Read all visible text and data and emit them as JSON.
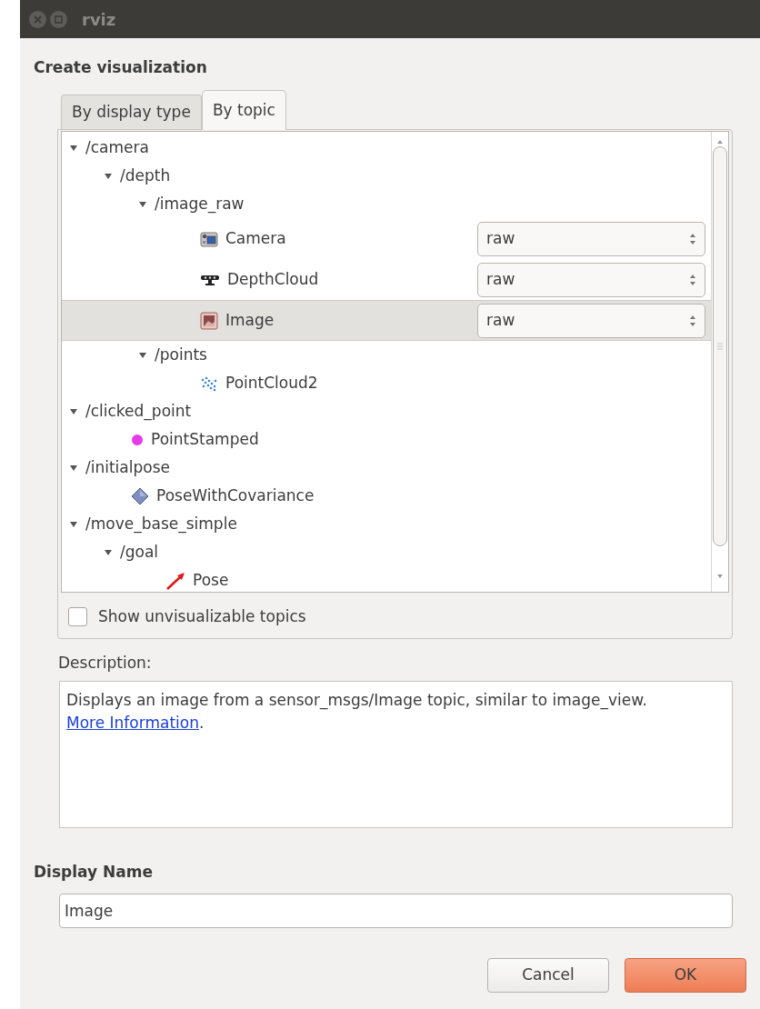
{
  "window": {
    "title": "rviz"
  },
  "heading": "Create visualization",
  "tabs": [
    {
      "label": "By display type",
      "selected": false
    },
    {
      "label": "By topic",
      "selected": true
    }
  ],
  "tree": [
    {
      "kind": "topic",
      "label": "/camera",
      "expanded": true,
      "selected": false,
      "children": [
        {
          "kind": "topic",
          "label": "/depth",
          "expanded": true,
          "selected": false,
          "children": [
            {
              "kind": "topic",
              "label": "/image_raw",
              "expanded": true,
              "selected": false,
              "children": [
                {
                  "kind": "camera",
                  "label": "Camera",
                  "selected": false,
                  "transport": "raw"
                },
                {
                  "kind": "depth-cloud",
                  "label": "DepthCloud",
                  "selected": false,
                  "transport": "raw"
                },
                {
                  "kind": "image",
                  "label": "Image",
                  "selected": true,
                  "transport": "raw"
                }
              ]
            },
            {
              "kind": "topic",
              "label": "/points",
              "expanded": true,
              "selected": false,
              "children": [
                {
                  "kind": "point-cloud",
                  "label": "PointCloud2",
                  "selected": false
                }
              ]
            }
          ]
        }
      ]
    },
    {
      "kind": "topic",
      "label": "/clicked_point",
      "expanded": true,
      "selected": false,
      "children": [
        {
          "kind": "point",
          "label": "PointStamped",
          "selected": false
        }
      ]
    },
    {
      "kind": "topic",
      "label": "/initialpose",
      "expanded": true,
      "selected": false,
      "children": [
        {
          "kind": "pose-covariance",
          "label": "PoseWithCovariance",
          "selected": false
        }
      ]
    },
    {
      "kind": "topic",
      "label": "/move_base_simple",
      "expanded": true,
      "selected": false,
      "children": [
        {
          "kind": "topic",
          "label": "/goal",
          "expanded": true,
          "selected": false,
          "children": [
            {
              "kind": "pose",
              "label": "Pose",
              "selected": false
            }
          ]
        }
      ]
    }
  ],
  "show_unvisualizable": {
    "label": "Show unvisualizable topics",
    "checked": false
  },
  "description": {
    "label": "Description:",
    "text": "Displays an image from a sensor_msgs/Image topic, similar to image_view. ",
    "link": "More Information",
    "after": "."
  },
  "display_name": {
    "label": "Display Name",
    "value": "Image"
  },
  "buttons": [
    {
      "label": "Cancel",
      "kind": "normal"
    },
    {
      "label": "OK",
      "kind": "default"
    }
  ]
}
